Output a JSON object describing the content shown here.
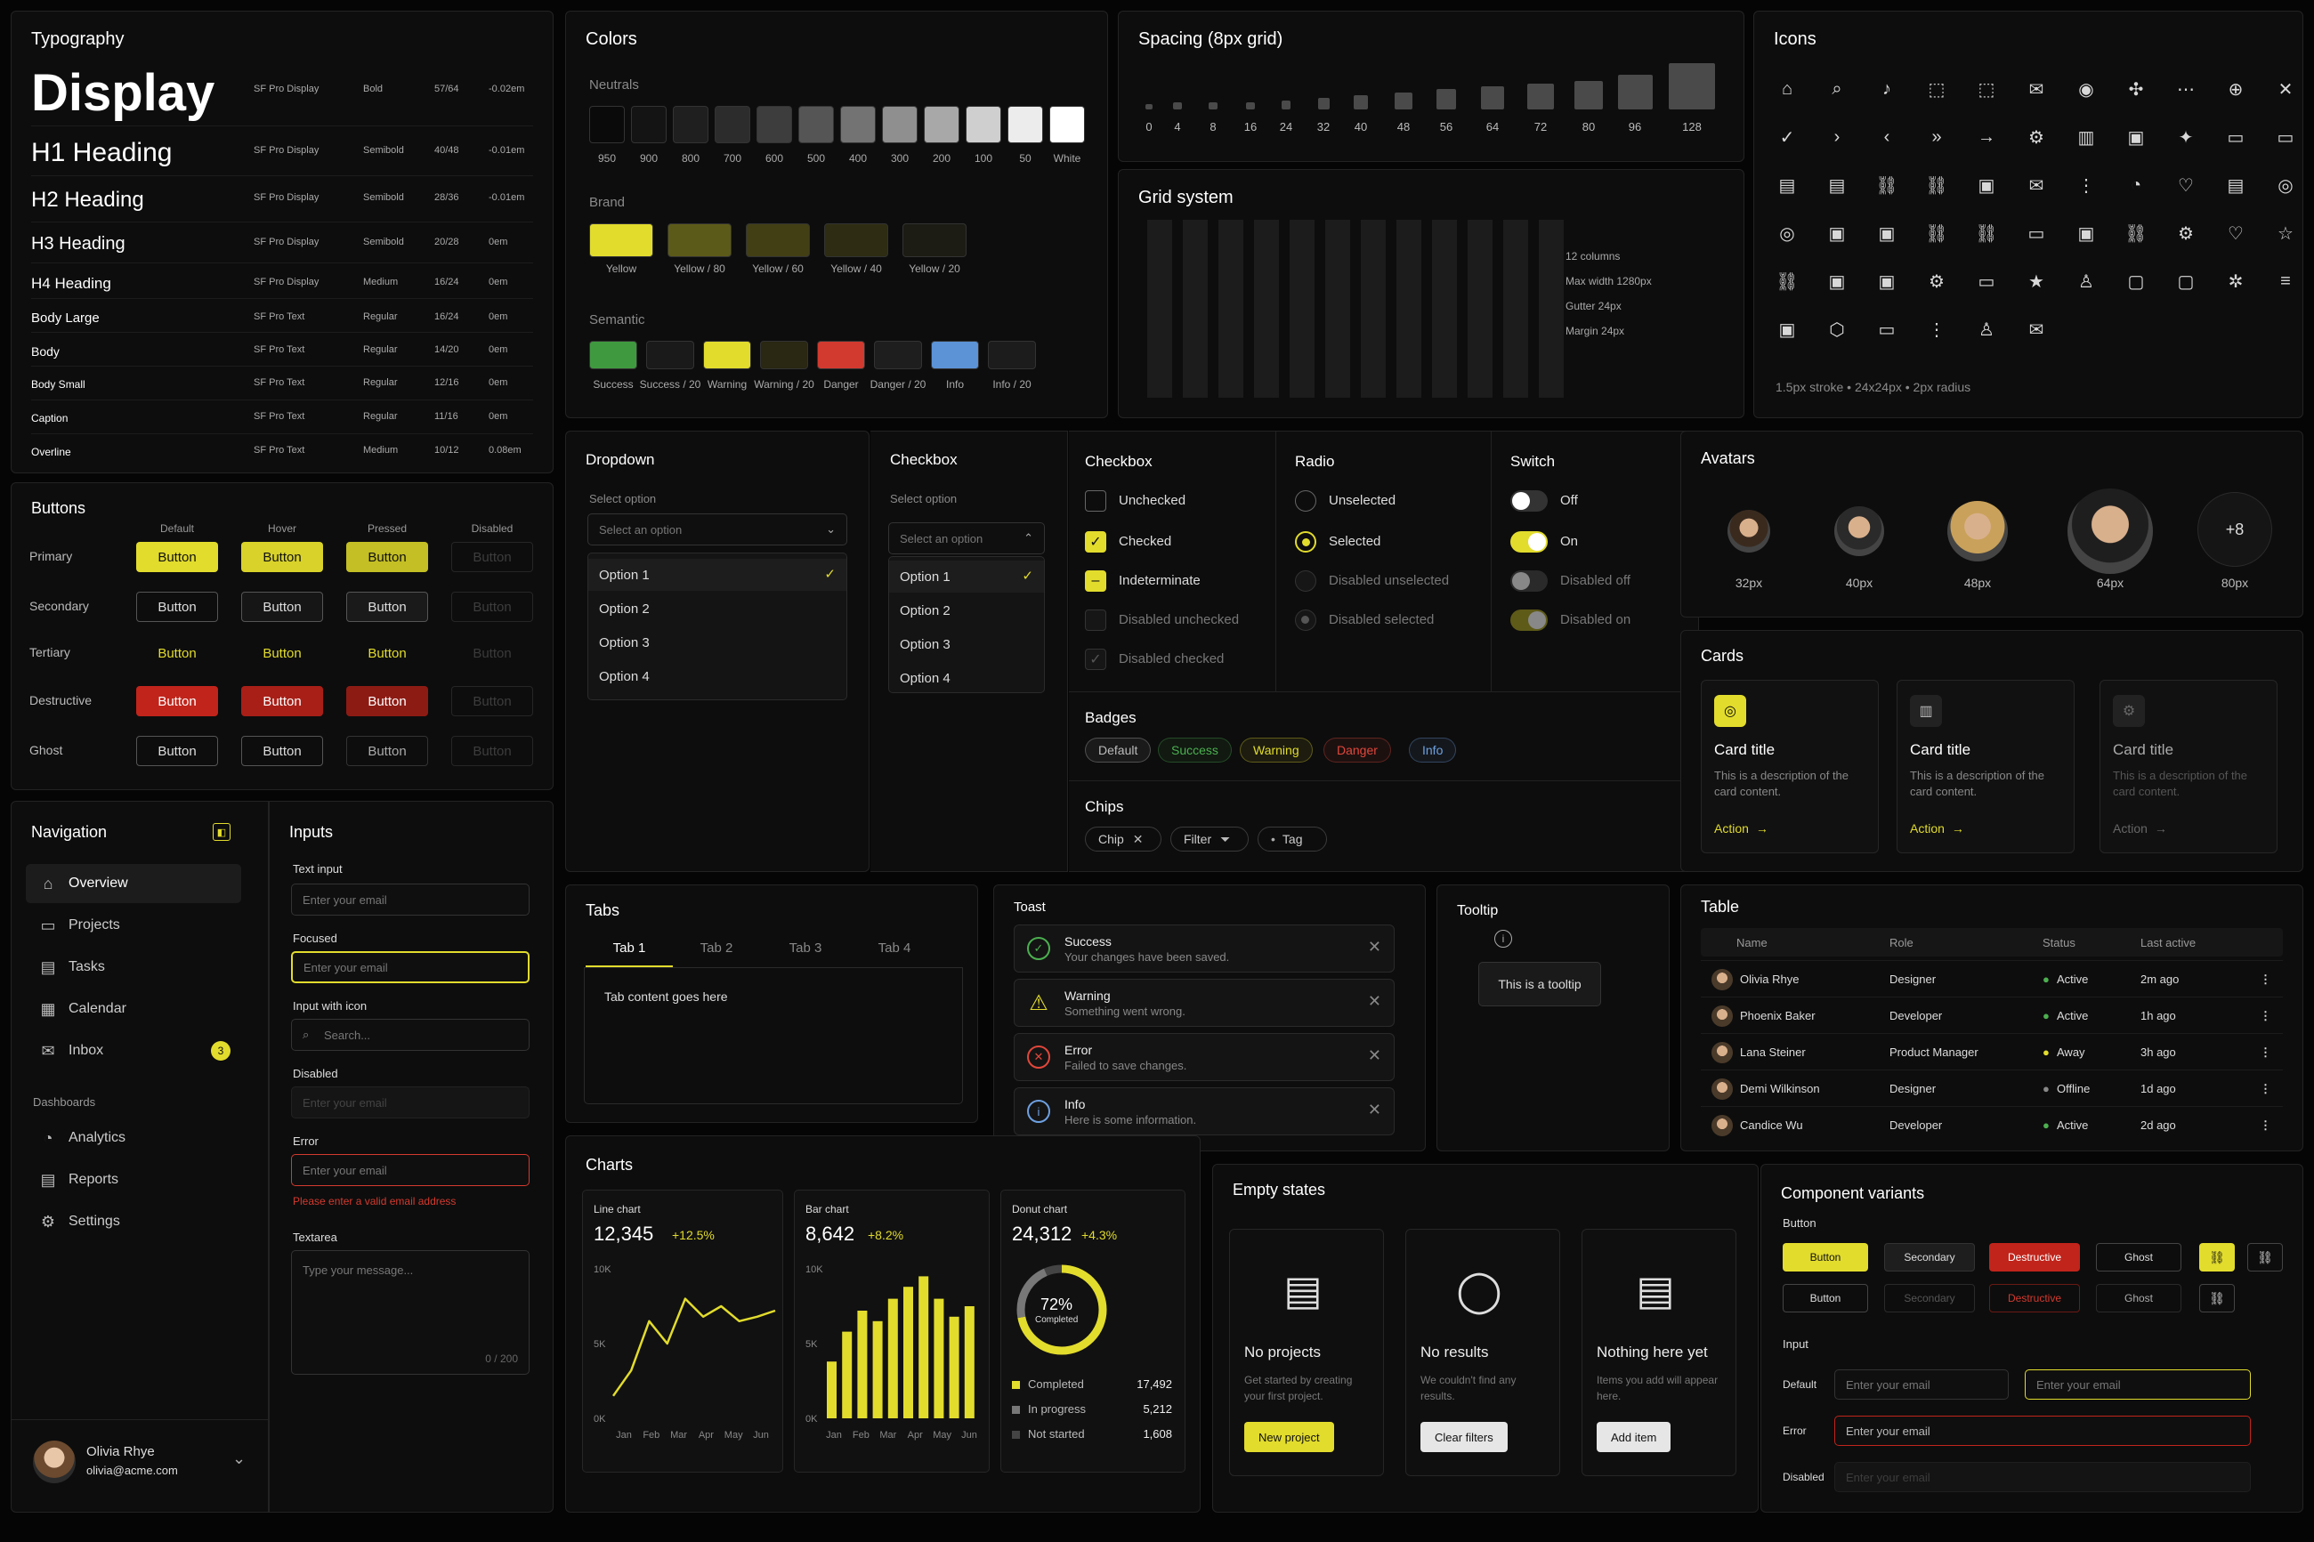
{
  "typography": {
    "title": "Typography",
    "rows": [
      {
        "name": "Display",
        "font": "SF Pro Display",
        "weight": "Bold",
        "size": "57/64",
        "track": "-0.02em"
      },
      {
        "name": "H1 Heading",
        "font": "SF Pro Display",
        "weight": "Semibold",
        "size": "40/48",
        "track": "-0.01em"
      },
      {
        "name": "H2 Heading",
        "font": "SF Pro Display",
        "weight": "Semibold",
        "size": "28/36",
        "track": "-0.01em"
      },
      {
        "name": "H3 Heading",
        "font": "SF Pro Display",
        "weight": "Semibold",
        "size": "20/28",
        "track": "0em"
      },
      {
        "name": "H4 Heading",
        "font": "SF Pro Display",
        "weight": "Medium",
        "size": "16/24",
        "track": "0em"
      },
      {
        "name": "Body Large",
        "font": "SF Pro Text",
        "weight": "Regular",
        "size": "16/24",
        "track": "0em"
      },
      {
        "name": "Body",
        "font": "SF Pro Text",
        "weight": "Regular",
        "size": "14/20",
        "track": "0em"
      },
      {
        "name": "Body Small",
        "font": "SF Pro Text",
        "weight": "Regular",
        "size": "12/16",
        "track": "0em"
      },
      {
        "name": "Caption",
        "font": "SF Pro Text",
        "weight": "Regular",
        "size": "11/16",
        "track": "0em"
      },
      {
        "name": "Overline",
        "font": "SF Pro Text",
        "weight": "Medium",
        "size": "10/12",
        "track": "0.08em"
      }
    ]
  },
  "colors": {
    "title": "Colors",
    "neutrals_label": "Neutrals",
    "neutrals": [
      {
        "label": "950",
        "hex": "#0a0a0a"
      },
      {
        "label": "900",
        "hex": "#141414"
      },
      {
        "label": "800",
        "hex": "#1f1f1f"
      },
      {
        "label": "700",
        "hex": "#2c2c2c"
      },
      {
        "label": "600",
        "hex": "#3d3d3d"
      },
      {
        "label": "500",
        "hex": "#555555"
      },
      {
        "label": "400",
        "hex": "#737373"
      },
      {
        "label": "300",
        "hex": "#8f8f8f"
      },
      {
        "label": "200",
        "hex": "#a8a8a8"
      },
      {
        "label": "100",
        "hex": "#cfcfcf"
      },
      {
        "label": "50",
        "hex": "#ececec"
      },
      {
        "label": "White",
        "hex": "#ffffff"
      }
    ],
    "brand_label": "Brand",
    "brand": [
      {
        "label": "Yellow",
        "hex": "#e2dc2d"
      },
      {
        "label": "Yellow / 80",
        "hex": "#5c5a18"
      },
      {
        "label": "Yellow / 60",
        "hex": "#433f15"
      },
      {
        "label": "Yellow / 40",
        "hex": "#2e2c12"
      },
      {
        "label": "Yellow / 20",
        "hex": "#1c1c14"
      }
    ],
    "semantic_label": "Semantic",
    "semantic": [
      {
        "label": "Success",
        "hex": "#3f9a3f"
      },
      {
        "label": "Success / 20",
        "hex": "#1a1a1a"
      },
      {
        "label": "Warning",
        "hex": "#e2dc2d"
      },
      {
        "label": "Warning / 20",
        "hex": "#2a2712"
      },
      {
        "label": "Danger",
        "hex": "#d33a2f"
      },
      {
        "label": "Danger / 20",
        "hex": "#1e1e1e"
      },
      {
        "label": "Info",
        "hex": "#5b93d6"
      },
      {
        "label": "Info / 20",
        "hex": "#1c1c1c"
      }
    ]
  },
  "spacing": {
    "title": "Spacing (8px grid)",
    "steps": [
      "0",
      "4",
      "8",
      "16",
      "24",
      "32",
      "40",
      "48",
      "56",
      "64",
      "72",
      "80",
      "96",
      "128"
    ]
  },
  "grid": {
    "title": "Grid system",
    "info": [
      "12 columns",
      "Max width 1280px",
      "Gutter 24px",
      "Margin 24px"
    ]
  },
  "icons": {
    "title": "Icons",
    "caption": "1.5px stroke • 24x24px • 2px radius",
    "glyphs": [
      "⌂",
      "⌕",
      "♪",
      "⬚",
      "⬚",
      "✉",
      "◉",
      "✣",
      "⋯",
      "⊕",
      "✕",
      "✓",
      "›",
      "‹",
      "»",
      "→",
      "⚙",
      "▥",
      "▣",
      "✦",
      "▭",
      "▭",
      "▤",
      "▤",
      "⛓",
      "⛓",
      "▣",
      "✉",
      "⋮",
      "◔",
      "♡",
      "▤",
      "◎",
      "◎",
      "▣",
      "▣",
      "⛓",
      "⛓",
      "▭",
      "▣",
      "⛓",
      "⚙",
      "♡",
      "☆",
      "⛓",
      "▣",
      "▣",
      "⚙",
      "▭",
      "★",
      "♙",
      "▢",
      "▢",
      "✲",
      "≡",
      "▣",
      "⬡",
      "▭",
      "⋮",
      "♙",
      "✉"
    ]
  },
  "buttons": {
    "title": "Buttons",
    "states": [
      "Default",
      "Hover",
      "Pressed",
      "Disabled"
    ],
    "types": [
      "Primary",
      "Secondary",
      "Tertiary",
      "Destructive",
      "Ghost"
    ],
    "label": "Button"
  },
  "dropdown": {
    "title": "Dropdown",
    "label": "Select option",
    "placeholder": "Select an option",
    "options": [
      "Option 1",
      "Option 2",
      "Option 3",
      "Option 4"
    ]
  },
  "checkbox_dd": {
    "title": "Checkbox",
    "label": "Select option",
    "placeholder": "Select an option",
    "options": [
      "Option 1",
      "Option 2",
      "Option 3",
      "Option 4"
    ]
  },
  "checkbox": {
    "title": "Checkbox",
    "items": [
      "Unchecked",
      "Checked",
      "Indeterminate",
      "Disabled unchecked",
      "Disabled checked"
    ]
  },
  "radio": {
    "title": "Radio",
    "items": [
      "Unselected",
      "Selected",
      "Disabled unselected",
      "Disabled selected"
    ]
  },
  "switch": {
    "title": "Switch",
    "items": [
      "Off",
      "On",
      "Disabled off",
      "Disabled on"
    ]
  },
  "badges": {
    "title": "Badges",
    "items": [
      {
        "label": "Default",
        "color": "#bbbbbb"
      },
      {
        "label": "Success",
        "color": "#4caf50"
      },
      {
        "label": "Warning",
        "color": "#e2dc2d"
      },
      {
        "label": "Danger",
        "color": "#e0473b"
      },
      {
        "label": "Info",
        "color": "#6ea0e0"
      }
    ]
  },
  "chips": {
    "title": "Chips",
    "items": [
      "Chip",
      "Filter",
      "Tag"
    ]
  },
  "avatars": {
    "title": "Avatars",
    "sizes": [
      "32px",
      "40px",
      "48px",
      "64px",
      "80px"
    ],
    "more": "+8"
  },
  "cards": {
    "title": "Cards",
    "items": [
      {
        "title": "Card title",
        "desc": "This is a description of the card content.",
        "action": "Action"
      },
      {
        "title": "Card title",
        "desc": "This is a description of the card content.",
        "action": "Action"
      },
      {
        "title": "Card title",
        "desc": "This is a description of the card content.",
        "action": "Action"
      }
    ]
  },
  "navigation": {
    "title": "Navigation",
    "items": [
      "Overview",
      "Projects",
      "Tasks",
      "Calendar",
      "Inbox"
    ],
    "inbox_count": "3",
    "section": "Dashboards",
    "dash": [
      "Analytics",
      "Reports",
      "Settings"
    ],
    "user": {
      "name": "Olivia Rhye",
      "email": "olivia@acme.com"
    }
  },
  "inputs": {
    "title": "Inputs",
    "text_label": "Text input",
    "text_ph": "Enter your email",
    "focused_label": "Focused",
    "focused_ph": "Enter your email",
    "icon_label": "Input with icon",
    "icon_ph": "Search...",
    "disabled_label": "Disabled",
    "disabled_ph": "Enter your email",
    "error_label": "Error",
    "error_ph": "Enter your email",
    "error_msg": "Please enter a valid email address",
    "textarea_label": "Textarea",
    "textarea_ph": "Type your message...",
    "counter": "0 / 200"
  },
  "tabs": {
    "title": "Tabs",
    "items": [
      "Tab 1",
      "Tab 2",
      "Tab 3",
      "Tab 4"
    ],
    "content": "Tab content goes here"
  },
  "toast": {
    "title": "Toast",
    "items": [
      {
        "title": "Success",
        "msg": "Your changes have been saved.",
        "color": "#4caf50",
        "icon": "✓"
      },
      {
        "title": "Warning",
        "msg": "Something went wrong.",
        "color": "#e2dc2d",
        "icon": "!"
      },
      {
        "title": "Error",
        "msg": "Failed to save changes.",
        "color": "#e0473b",
        "icon": "✕"
      },
      {
        "title": "Info",
        "msg": "Here is some information.",
        "color": "#6ea0e0",
        "icon": "i"
      }
    ]
  },
  "tooltip": {
    "title": "Tooltip",
    "text": "This is a tooltip"
  },
  "table": {
    "title": "Table",
    "headers": [
      "Name",
      "Role",
      "Status",
      "Last active"
    ],
    "rows": [
      {
        "name": "Olivia Rhye",
        "role": "Designer",
        "status": "Active",
        "last": "2m ago",
        "color": "#4caf50"
      },
      {
        "name": "Phoenix Baker",
        "role": "Developer",
        "status": "Active",
        "last": "1h ago",
        "color": "#4caf50"
      },
      {
        "name": "Lana Steiner",
        "role": "Product Manager",
        "status": "Away",
        "last": "3h ago",
        "color": "#e2dc2d"
      },
      {
        "name": "Demi Wilkinson",
        "role": "Designer",
        "status": "Offline",
        "last": "1d ago",
        "color": "#888888"
      },
      {
        "name": "Candice Wu",
        "role": "Developer",
        "status": "Active",
        "last": "2d ago",
        "color": "#4caf50"
      }
    ]
  },
  "charts": {
    "title": "Charts",
    "line": {
      "label": "Line chart",
      "value": "12,345",
      "delta": "+12.5%"
    },
    "bar": {
      "label": "Bar chart",
      "value": "8,642",
      "delta": "+8.2%"
    },
    "donut": {
      "label": "Donut chart",
      "value": "24,312",
      "delta": "+4.3%",
      "pct": "72%",
      "pct_label": "Completed",
      "legend": [
        {
          "label": "Completed",
          "value": "17,492"
        },
        {
          "label": "In progress",
          "value": "5,212"
        },
        {
          "label": "Not started",
          "value": "1,608"
        }
      ]
    }
  },
  "chart_data": [
    {
      "type": "line",
      "categories": [
        "Jan",
        "Feb",
        "Mar",
        "Apr",
        "May",
        "Jun"
      ],
      "yticks": [
        "0K",
        "5K",
        "10K"
      ],
      "ylim": [
        0,
        10000
      ],
      "values": [
        1500,
        3200,
        6500,
        5000,
        8000,
        6800,
        7500,
        6500,
        6800,
        7200
      ]
    },
    {
      "type": "bar",
      "categories": [
        "Jan",
        "Feb",
        "Mar",
        "Apr",
        "May",
        "Jun"
      ],
      "yticks": [
        "0K",
        "5K",
        "10K"
      ],
      "ylim": [
        0,
        10000
      ],
      "values": [
        3800,
        5800,
        7200,
        6500,
        8000,
        8800,
        9500,
        8000,
        6800,
        7500
      ]
    },
    {
      "type": "pie",
      "series": [
        {
          "name": "Completed",
          "value": 17492
        },
        {
          "name": "In progress",
          "value": 5212
        },
        {
          "name": "Not started",
          "value": 1608
        }
      ]
    }
  ],
  "empty": {
    "title": "Empty states",
    "items": [
      {
        "title": "No projects",
        "desc": "Get started by creating your first project.",
        "btn": "New project"
      },
      {
        "title": "No results",
        "desc": "We couldn't find any results.",
        "btn": "Clear filters"
      },
      {
        "title": "Nothing here yet",
        "desc": "Items you add will appear here.",
        "btn": "Add item"
      }
    ]
  },
  "variants": {
    "title": "Component variants",
    "button_label": "Button",
    "row1": [
      "Button",
      "Secondary",
      "Destructive",
      "Ghost"
    ],
    "row2": [
      "Button",
      "Secondary",
      "Destructive",
      "Ghost"
    ],
    "input_label": "Input",
    "default_label": "Default",
    "error_label": "Error",
    "disabled_label": "Disabled",
    "ph": "Enter your email"
  }
}
